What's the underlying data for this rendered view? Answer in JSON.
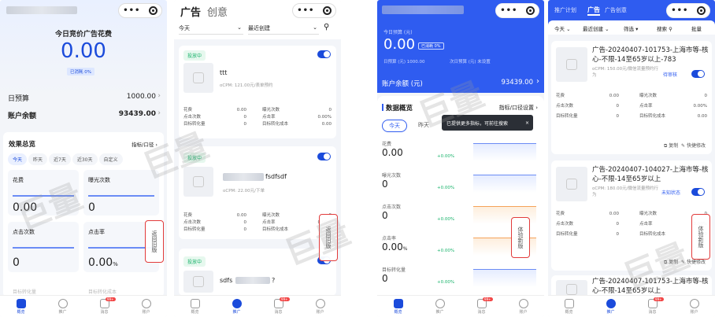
{
  "p1": {
    "spend_title": "今日竞价广告花费",
    "spend_value": "0.00",
    "consumed": "已消耗 0%",
    "daily_budget_label": "日预算",
    "daily_budget_value": "1000.00",
    "balance_label": "账户余额",
    "balance_value": "93439.00",
    "summary_title": "效果总览",
    "metric_caliber": "指标/口径",
    "ranges": [
      "今天",
      "昨天",
      "近7天",
      "近30天",
      "自定义"
    ],
    "metrics": [
      {
        "label": "花费",
        "value": "0.00"
      },
      {
        "label": "曝光次数",
        "value": "0"
      },
      {
        "label": "点击次数",
        "value": "0"
      },
      {
        "label": "点击率",
        "value": "0.00",
        "unit": "%"
      }
    ],
    "cut_label": "目标转化量",
    "cut_label_right": "目标转化成本",
    "side_tab": "返回旧版",
    "nav": [
      "概览",
      "推广",
      "消息",
      "账户"
    ]
  },
  "p2": {
    "tab_ad": "广告",
    "tab_idea": "创意",
    "filter_date": "今天",
    "filter_sort": "最近创建",
    "ads": [
      {
        "status": "投放中",
        "name": "ttt",
        "bid": "oCPM: 121.00元/表单预约",
        "stats": [
          [
            "花费",
            "0.00",
            "曝光次数",
            "0"
          ],
          [
            "点击次数",
            "0",
            "点击率",
            "0.00%"
          ],
          [
            "目标转化量",
            "0",
            "目标转化成本",
            "0.00"
          ]
        ]
      },
      {
        "status": "投放中",
        "name": "fsdfsdf",
        "bid": "oCPM: 22.00元/下单",
        "stats": [
          [
            "花费",
            "0.00",
            "曝光次数",
            "0"
          ],
          [
            "点击次数",
            "0",
            "点击率",
            "0.00%"
          ],
          [
            "目标转化量",
            "0",
            "目标转化成本",
            "0.00"
          ]
        ]
      },
      {
        "status": "投放中",
        "name": "sdfs",
        "name_tail": "?"
      }
    ],
    "side_tab": "返回旧版",
    "nav": [
      "概览",
      "推广",
      "消息",
      "账户"
    ],
    "badge": "99+"
  },
  "p3": {
    "budget_today": "今日预算 (元)",
    "spend": "0.00",
    "consumed": "已消耗 0%",
    "daily_budget": "日预算 (元) 1000.00",
    "tomorrow_budget": "次日预算 (元) 未设置",
    "balance_label": "账户余额 (元)",
    "balance_value": "93439.00",
    "overview_title": "数据概览",
    "metric_settings": "指标/口径设置",
    "tooltip": "已提供更多指标，可前往搜索",
    "ranges": [
      "今天",
      "昨天"
    ],
    "metrics": [
      {
        "label": "花费",
        "value": "0.00",
        "pct": "+0.00%"
      },
      {
        "label": "曝光次数",
        "value": "0",
        "pct": "+0.00%"
      },
      {
        "label": "点击次数",
        "value": "0",
        "pct": "+0.00%"
      },
      {
        "label": "点击率",
        "value": "0.00",
        "unit": "%",
        "pct": "+0.00%"
      },
      {
        "label": "目标转化量",
        "value": "0",
        "pct": "+0.00%"
      }
    ],
    "side_tab": "体验新版",
    "nav": [
      "概览",
      "推广",
      "消息",
      "账户"
    ],
    "badge": "99+",
    "colors": {
      "header": "#2f5cf0",
      "spark_blue": "#6b8cf5",
      "spark_orange": "#f5a35a"
    }
  },
  "p4": {
    "tabs": [
      "推广计划",
      "广告",
      "广告创意"
    ],
    "filters": [
      "今天",
      "最近创建",
      "筛选",
      "搜索",
      "批量"
    ],
    "ads": [
      {
        "title": "广告-20240407-101753-上海市等-核心-不限-14至65岁以上-783",
        "bid": "oCPM: 150.00元/微信流量预约行为",
        "state": "待审核",
        "stats": [
          [
            "花费",
            "0.00",
            "曝光次数",
            "0"
          ],
          [
            "点击次数",
            "0",
            "点击率",
            "0.00%"
          ],
          [
            "目标转化量",
            "0",
            "目标转化成本",
            "0.00"
          ]
        ]
      },
      {
        "title": "广告-20240407-104027-上海市等-核心-不限-14至65岁以上",
        "bid": "oCPM: 180.00元/微信流量预约行为",
        "state": "未知状态",
        "stats": [
          [
            "花费",
            "0.00",
            "曝光次数",
            "0"
          ],
          [
            "点击次数",
            "0",
            "点击率",
            "0.00%"
          ],
          [
            "目标转化量",
            "0",
            "目标转化成本",
            "0.00"
          ]
        ]
      },
      {
        "title": "广告-20240407-101753-上海市等-核心-不限-14至65岁以上"
      }
    ],
    "actions": [
      "复制",
      "快捷修改"
    ],
    "side_tab": "体验新版",
    "nav": [
      "概览",
      "推广",
      "消息",
      "账户"
    ],
    "badge": "99+"
  },
  "watermark": "巨量"
}
